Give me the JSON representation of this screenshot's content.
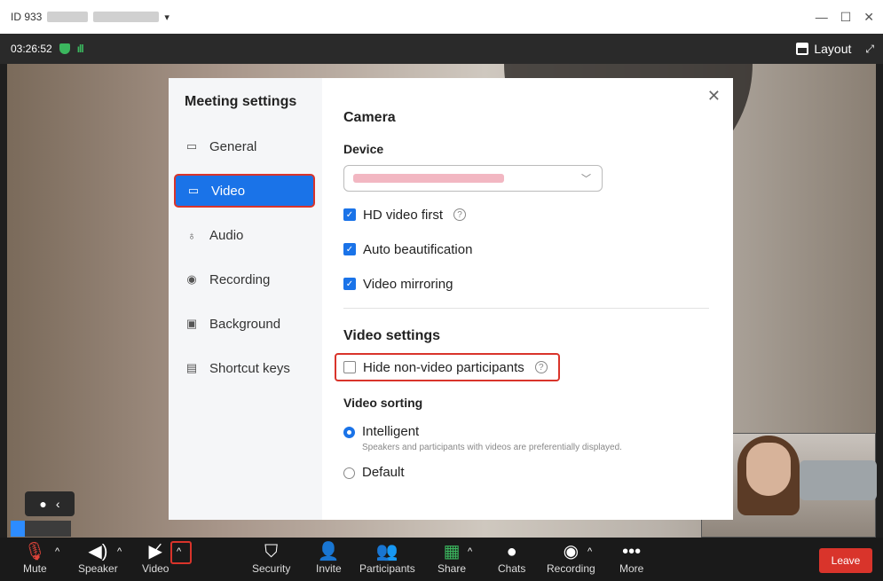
{
  "window": {
    "meeting_id": "ID 933",
    "minimize": "—",
    "maximize": "☐",
    "close": "✕"
  },
  "topbar": {
    "time": "03:26:52",
    "signal": "ıll",
    "layout_label": "Layout"
  },
  "dialog": {
    "title": "Meeting settings",
    "nav": [
      {
        "label": "General",
        "icon": "general-icon"
      },
      {
        "label": "Video",
        "icon": "video-icon"
      },
      {
        "label": "Audio",
        "icon": "microphone-icon"
      },
      {
        "label": "Recording",
        "icon": "record-icon"
      },
      {
        "label": "Background",
        "icon": "background-icon"
      },
      {
        "label": "Shortcut keys",
        "icon": "keyboard-icon"
      }
    ],
    "camera_title": "Camera",
    "device_label": "Device",
    "hd_video_first": "HD video first",
    "auto_beautification": "Auto beautification",
    "video_mirroring": "Video mirroring",
    "video_settings_title": "Video settings",
    "hide_non_video": "Hide non-video participants",
    "video_sorting_title": "Video sorting",
    "intelligent_label": "Intelligent",
    "intelligent_hint": "Speakers and participants with videos are preferentially displayed.",
    "default_label": "Default"
  },
  "toolbar": {
    "mute": "Mute",
    "speaker": "Speaker",
    "video": "Video",
    "security": "Security",
    "invite": "Invite",
    "participants": "Participants",
    "share": "Share",
    "chats": "Chats",
    "recording": "Recording",
    "more": "More",
    "leave": "Leave"
  }
}
